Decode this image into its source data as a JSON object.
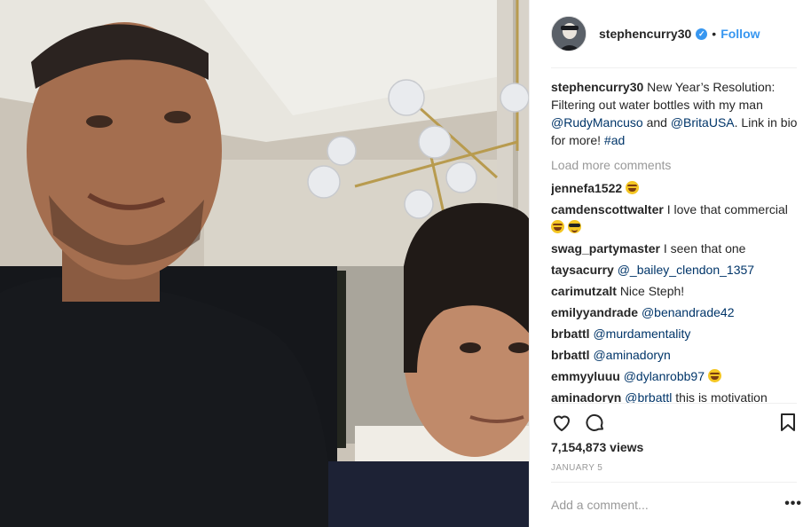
{
  "colors": {
    "accent": "#3897f0",
    "mention": "#003569",
    "muted": "#999999",
    "divider": "#efefef"
  },
  "media": {
    "type": "video-frame",
    "description_icon": "video-frame"
  },
  "header": {
    "username": "stephencurry30",
    "verified_icon": "verified-badge-icon",
    "separator": "•",
    "follow_label": "Follow"
  },
  "caption": {
    "username": "stephencurry30",
    "text_1": "New Year’s Resolution: Filtering out water bottles with my man ",
    "mention_1": "@RudyMancuso",
    "text_2": " and ",
    "mention_2": "@BritaUSA",
    "text_3": ". Link in bio for more! ",
    "hashtag": "#ad"
  },
  "load_more_label": "Load more comments",
  "comments": [
    {
      "user": "jennefa1522",
      "text": "",
      "mention": "",
      "emoji": [
        "laugh"
      ]
    },
    {
      "user": "camdenscottwalter",
      "text": "I love that commercial",
      "mention": "",
      "emoji": [
        "laugh",
        "cool"
      ]
    },
    {
      "user": "swag_partymaster",
      "text": "I seen that one",
      "mention": "",
      "emoji": []
    },
    {
      "user": "taysacurry",
      "text": "",
      "mention": "@_bailey_clendon_1357",
      "emoji": []
    },
    {
      "user": "carimutzalt",
      "text": "Nice Steph!",
      "mention": "",
      "emoji": []
    },
    {
      "user": "emilyyandrade",
      "text": "",
      "mention": "@benandrade42",
      "emoji": []
    },
    {
      "user": "brbattl",
      "text": "",
      "mention": "@murdamentality",
      "emoji": []
    },
    {
      "user": "brbattl",
      "text": "",
      "mention": "@aminadoryn",
      "emoji": []
    },
    {
      "user": "emmyyluuu",
      "text": "",
      "mention": "@dylanrobb97",
      "emoji": [
        "laugh"
      ]
    },
    {
      "user": "aminadoryn",
      "text": "this is motivation thank you",
      "mention": "@brbattl",
      "emoji": []
    }
  ],
  "actions": {
    "like_icon": "heart-icon",
    "comment_icon": "comment-bubble-icon",
    "save_icon": "bookmark-icon"
  },
  "views": "7,154,873 views",
  "date": "JANUARY 5",
  "add_comment": {
    "placeholder": "Add a comment...",
    "more_icon": "more-options-icon",
    "more_label": "•••"
  }
}
